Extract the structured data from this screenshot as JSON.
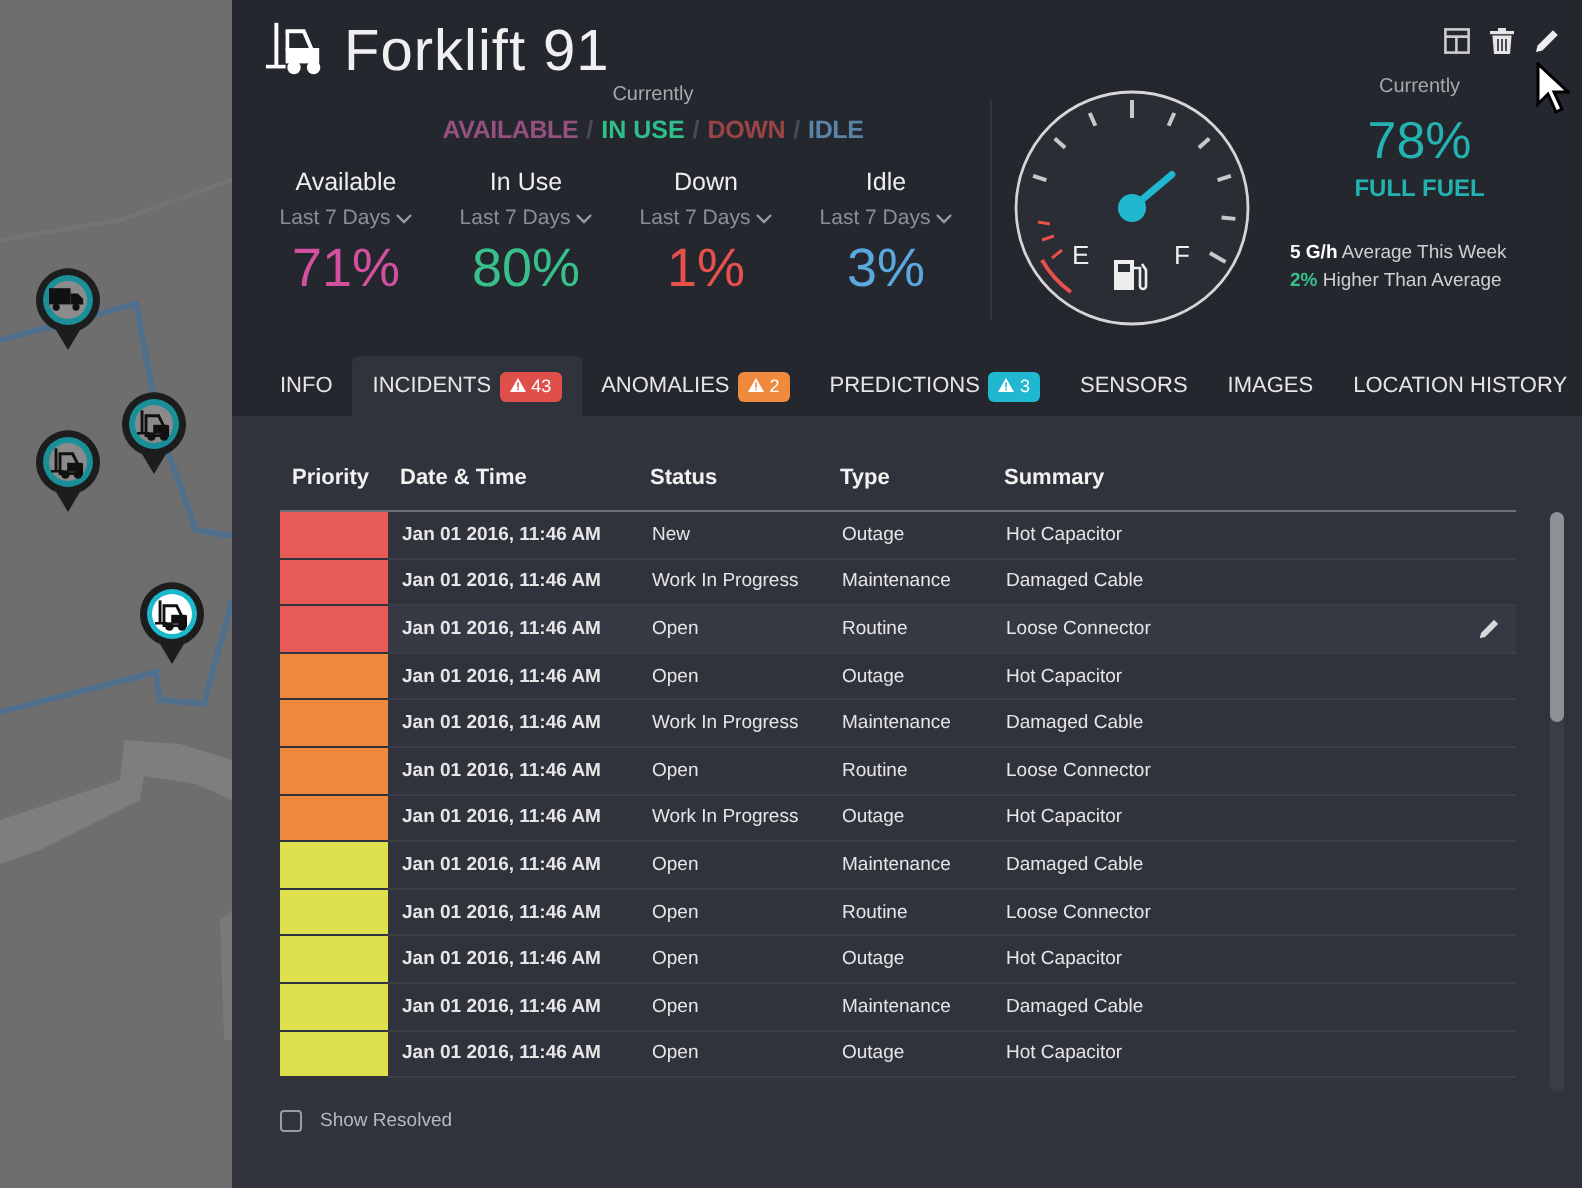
{
  "map": {
    "pins": [
      {
        "kind": "truck",
        "selected": false
      },
      {
        "kind": "forklift",
        "selected": false
      },
      {
        "kind": "forklift",
        "selected": false
      },
      {
        "kind": "forklift",
        "selected": true
      }
    ]
  },
  "header": {
    "title": "Forklift 91",
    "current_label": "Currently",
    "statuses": [
      {
        "label": "AVAILABLE",
        "color": "#94507e",
        "selected": false
      },
      {
        "label": "IN USE",
        "color": "#2fbf8a",
        "selected": true
      },
      {
        "label": "DOWN",
        "color": "#9a4446",
        "selected": false
      },
      {
        "label": "IDLE",
        "color": "#5a84a6",
        "selected": false
      }
    ],
    "separator": "/",
    "stats": [
      {
        "label": "Available",
        "range": "Last 7 Days",
        "value": "71%",
        "color": "#d2509e"
      },
      {
        "label": "In Use",
        "range": "Last 7 Days",
        "value": "80%",
        "color": "#38c08a"
      },
      {
        "label": "Down",
        "range": "Last 7 Days",
        "value": "1%",
        "color": "#e8504c"
      },
      {
        "label": "Idle",
        "range": "Last 7 Days",
        "value": "3%",
        "color": "#5aa8e0"
      }
    ]
  },
  "fuel": {
    "empty_label": "E",
    "full_label": "F",
    "current_label": "Currently",
    "value": "78%",
    "caption": "FULL FUEL",
    "notes": [
      {
        "text": "**5 G/h** Average This Week",
        "kind": "plain"
      },
      {
        "text": "**2%** Higher Than Average",
        "kind": "up"
      }
    ]
  },
  "tabs": [
    {
      "label": "INFO",
      "selected": false
    },
    {
      "label": "INCIDENTS",
      "selected": true,
      "badge": "43",
      "color": "#e0504a"
    },
    {
      "label": "ANOMALIES",
      "selected": false,
      "badge": "2",
      "color": "#ef8a3c"
    },
    {
      "label": "PREDICTIONS",
      "selected": false,
      "badge": "3",
      "color": "#1fb8d0"
    },
    {
      "label": "SENSORS",
      "selected": false
    },
    {
      "label": "IMAGES",
      "selected": false
    },
    {
      "label": "LOCATION HISTORY",
      "selected": false
    }
  ],
  "table": {
    "columns": [
      "Priority",
      "Date & Time",
      "Status",
      "Type",
      "Summary"
    ],
    "rows": [
      {
        "color": "#e85a58",
        "date": "Jan 01 2016, 11:46 AM",
        "status": "New",
        "type": "Outage",
        "summary": "Hot Capacitor",
        "hovered": false
      },
      {
        "color": "#e85a58",
        "date": "Jan 01 2016, 11:46 AM",
        "status": "Work In Progress",
        "type": "Maintenance",
        "summary": "Damaged Cable",
        "hovered": false
      },
      {
        "color": "#e85a58",
        "date": "Jan 01 2016, 11:46 AM",
        "status": "Open",
        "type": "Routine",
        "summary": "Loose Connector",
        "hovered": true
      },
      {
        "color": "#ee883c",
        "date": "Jan 01 2016, 11:46 AM",
        "status": "Open",
        "type": "Outage",
        "summary": "Hot Capacitor",
        "hovered": false
      },
      {
        "color": "#ee883c",
        "date": "Jan 01 2016, 11:46 AM",
        "status": "Work In Progress",
        "type": "Maintenance",
        "summary": "Damaged Cable",
        "hovered": false
      },
      {
        "color": "#ee883c",
        "date": "Jan 01 2016, 11:46 AM",
        "status": "Open",
        "type": "Routine",
        "summary": "Loose Connector",
        "hovered": false
      },
      {
        "color": "#ee883c",
        "date": "Jan 01 2016, 11:46 AM",
        "status": "Work In Progress",
        "type": "Outage",
        "summary": "Hot Capacitor",
        "hovered": false
      },
      {
        "color": "#dfe04e",
        "date": "Jan 01 2016, 11:46 AM",
        "status": "Open",
        "type": "Maintenance",
        "summary": "Damaged Cable",
        "hovered": false
      },
      {
        "color": "#dfe04e",
        "date": "Jan 01 2016, 11:46 AM",
        "status": "Open",
        "type": "Routine",
        "summary": "Loose Connector",
        "hovered": false
      },
      {
        "color": "#dfe04e",
        "date": "Jan 01 2016, 11:46 AM",
        "status": "Open",
        "type": "Outage",
        "summary": "Hot Capacitor",
        "hovered": false
      },
      {
        "color": "#dfe04e",
        "date": "Jan 01 2016, 11:46 AM",
        "status": "Open",
        "type": "Maintenance",
        "summary": "Damaged Cable",
        "hovered": false
      },
      {
        "color": "#dfe04e",
        "date": "Jan 01 2016, 11:46 AM",
        "status": "Open",
        "type": "Outage",
        "summary": "Hot Capacitor",
        "hovered": false
      }
    ]
  },
  "show_resolved": {
    "label": "Show Resolved",
    "checked": false
  }
}
